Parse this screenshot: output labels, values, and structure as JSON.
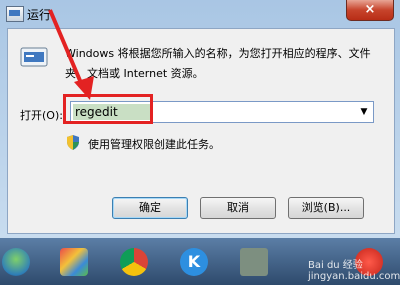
{
  "window": {
    "title": "运行",
    "close_label": "×"
  },
  "dialog": {
    "description": "Windows 将根据您所输入的名称，为您打开相应的程序、文件夹、文档或 Internet 资源。",
    "open_label": "打开(O):",
    "input_value": "regedit",
    "admin_note": "使用管理权限创建此任务。"
  },
  "buttons": {
    "ok": "确定",
    "cancel": "取消",
    "browse": "浏览(B)..."
  },
  "taskbar": {
    "icons": [
      "start-orb-icon",
      "paint-icon",
      "chrome-icon",
      "kugou-icon",
      "app-icon",
      "baidu-icon"
    ]
  },
  "watermark": "Bai du 经验 jingyan.baidu.com",
  "colors": {
    "highlight_box": "#e32222",
    "titlebar": "#a9c6e4",
    "close_button": "#c7442c"
  }
}
